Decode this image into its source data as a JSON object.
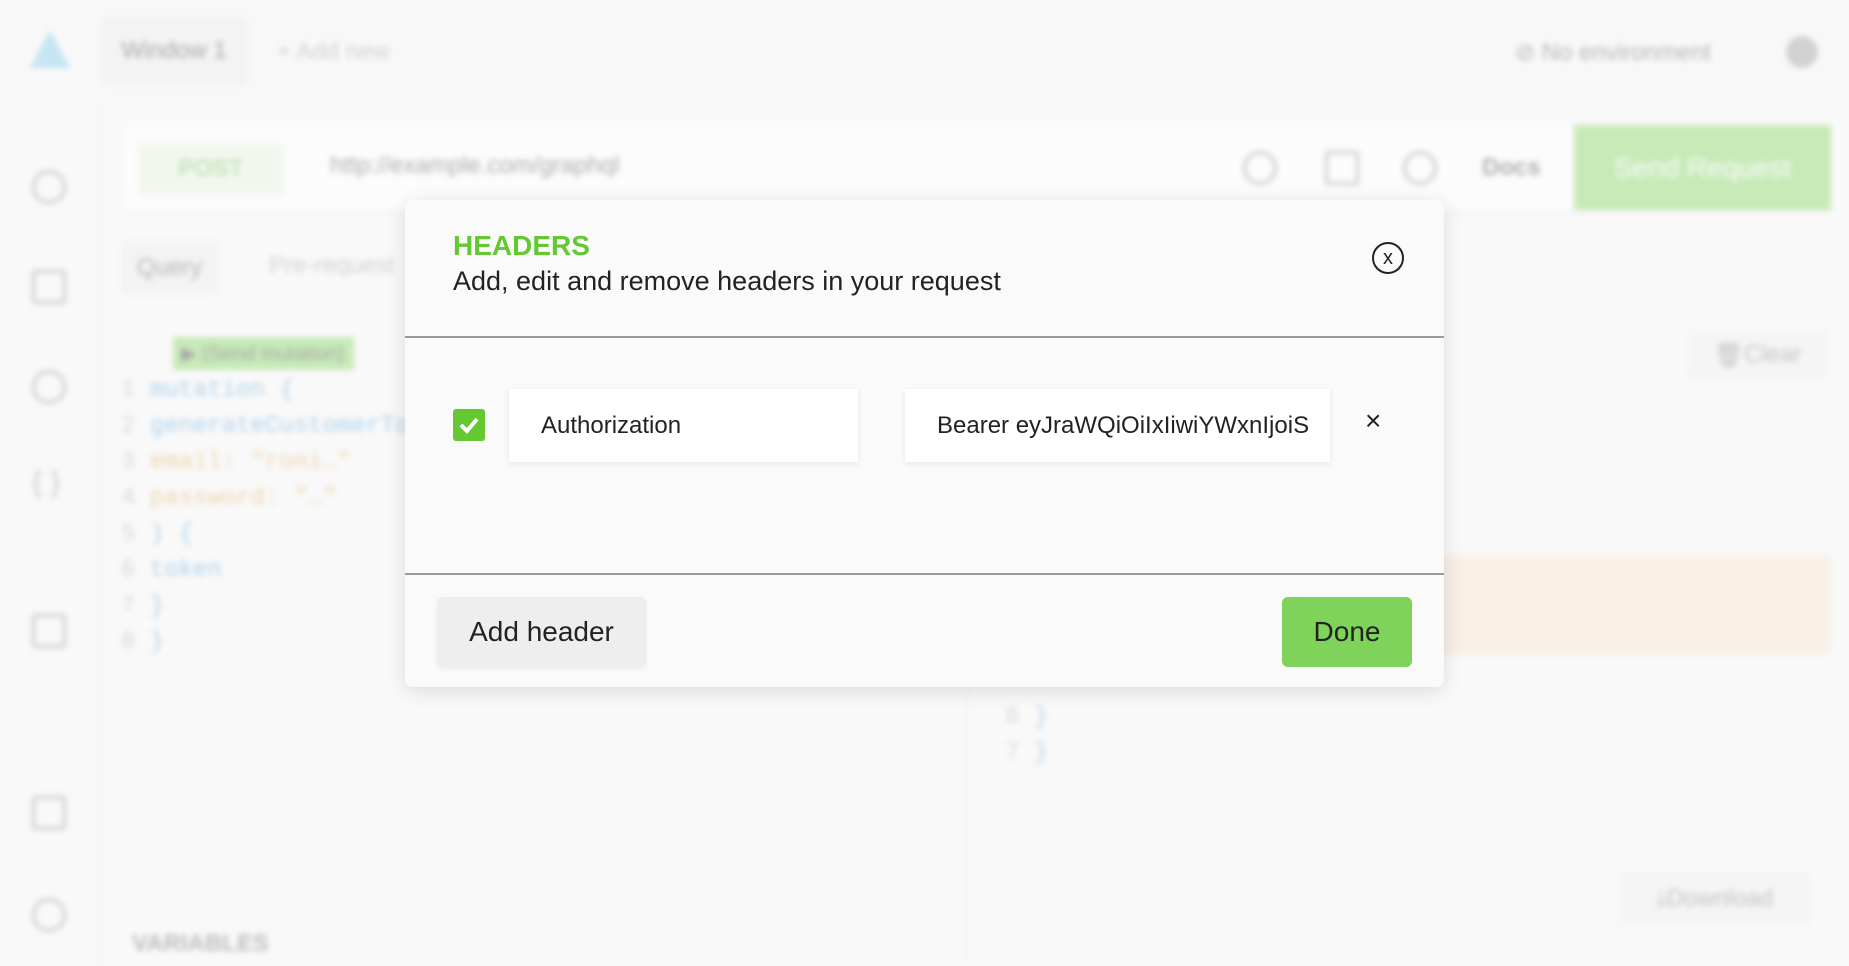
{
  "app": {
    "window_tab": "Window 1",
    "add_new": "+ Add new",
    "environment": "No environment"
  },
  "request": {
    "method": "POST",
    "url": "http://example.com/graphql",
    "docs": "Docs",
    "send": "Send Request"
  },
  "tabs": [
    "Query",
    "Pre-request"
  ],
  "editor": {
    "send_mutation": "▶ (Send mutation)",
    "lines": [
      {
        "n": "1",
        "code": "mutation {"
      },
      {
        "n": "2",
        "code": "  generateCustomerToken("
      },
      {
        "n": "3",
        "code": "    email: \"roni…\""
      },
      {
        "n": "4",
        "code": "    password: \"…\""
      },
      {
        "n": "5",
        "code": "  ) {"
      },
      {
        "n": "6",
        "code": "    token"
      },
      {
        "n": "7",
        "code": "  }"
      },
      {
        "n": "8",
        "code": "}"
      }
    ]
  },
  "result": {
    "clear": "Clear",
    "download": "Download",
    "lines": [
      {
        "n": "6",
        "code": "    }"
      },
      {
        "n": "7",
        "code": "  }"
      }
    ]
  },
  "variables_label": "VARIABLES",
  "dialog": {
    "title": "HEADERS",
    "subtitle": "Add, edit and remove headers in your request",
    "headers": [
      {
        "enabled": true,
        "key": "Authorization",
        "value": "Bearer eyJraWQiOiIxIiwiYWxnIjoiS"
      }
    ],
    "add_header": "Add header",
    "done": "Done"
  },
  "colors": {
    "accent": "#64c832",
    "button": "#7fd35a"
  }
}
